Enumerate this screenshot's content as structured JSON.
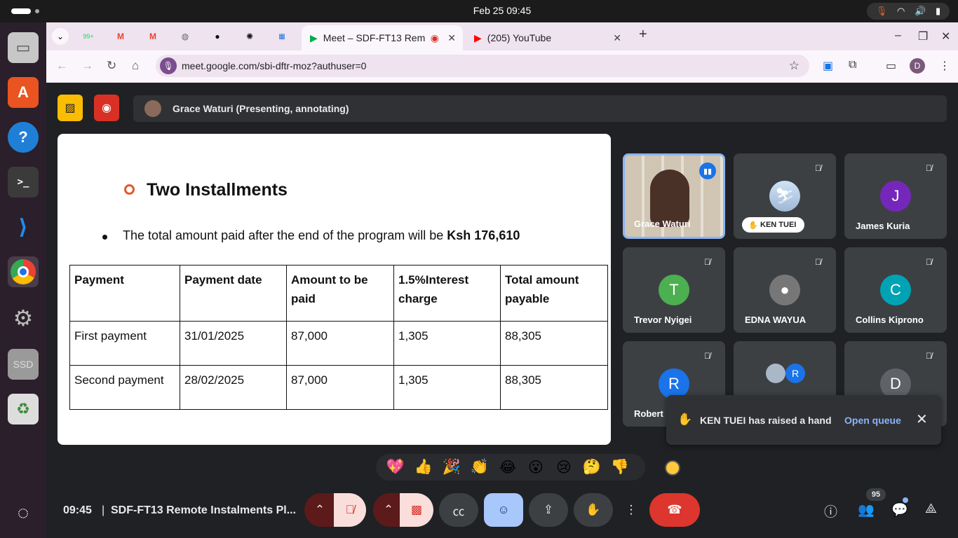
{
  "system": {
    "clock": "Feb 25  09:45"
  },
  "dock": {
    "ssd_label": "SSD"
  },
  "browser": {
    "pinned_badge": "99+",
    "tabs": [
      {
        "label": "Meet – SDF-FT13 Rem"
      },
      {
        "label": "(205) YouTube"
      }
    ],
    "url": "meet.google.com/sbi-dftr-moz?authuser=0",
    "profile_initial": "D"
  },
  "meet": {
    "presenter_banner": "Grace Waturi (Presenting, annotating)",
    "slide": {
      "heading": "Two Installments",
      "total_text_prefix": "The total amount paid after the end of the program will be ",
      "total_amount": "Ksh 176,610",
      "table": {
        "headers": [
          "Payment",
          "Payment date",
          "Amount to be paid",
          "1.5%Interest charge",
          "Total amount payable"
        ],
        "rows": [
          [
            "First payment",
            "31/01/2025",
            "87,000",
            "1,305",
            "88,305"
          ],
          [
            "Second payment",
            "28/02/2025",
            "87,000",
            "1,305",
            "88,305"
          ]
        ]
      }
    },
    "participants": [
      {
        "name": "Grace Waturi",
        "initial": "",
        "color": ""
      },
      {
        "name": "KEN TUEI",
        "initial": "",
        "color": ""
      },
      {
        "name": "James Kuria",
        "initial": "J",
        "color": "#7627bb"
      },
      {
        "name": "Trevor Nyigei",
        "initial": "T",
        "color": "#4caf50"
      },
      {
        "name": "EDNA WAYUA",
        "initial": "",
        "color": ""
      },
      {
        "name": "Collins Kiprono",
        "initial": "C",
        "color": "#00a3b4"
      },
      {
        "name": "Robert",
        "initial": "R",
        "color": "#1a73e8"
      },
      {
        "name": "",
        "initial": "R",
        "color": "#1a73e8"
      },
      {
        "name": "",
        "initial": "D",
        "color": "#5f6368"
      }
    ],
    "toast": {
      "message": "KEN TUEI has raised a hand",
      "link": "Open queue"
    },
    "reactions": [
      "💖",
      "👍",
      "🎉",
      "👏",
      "😂",
      "😮",
      "😢",
      "🤔",
      "👎"
    ],
    "bottom": {
      "time": "09:45",
      "separator": "|",
      "meeting_title": "SDF-FT13 Remote Instalments Pl...",
      "people_count": "95"
    }
  }
}
